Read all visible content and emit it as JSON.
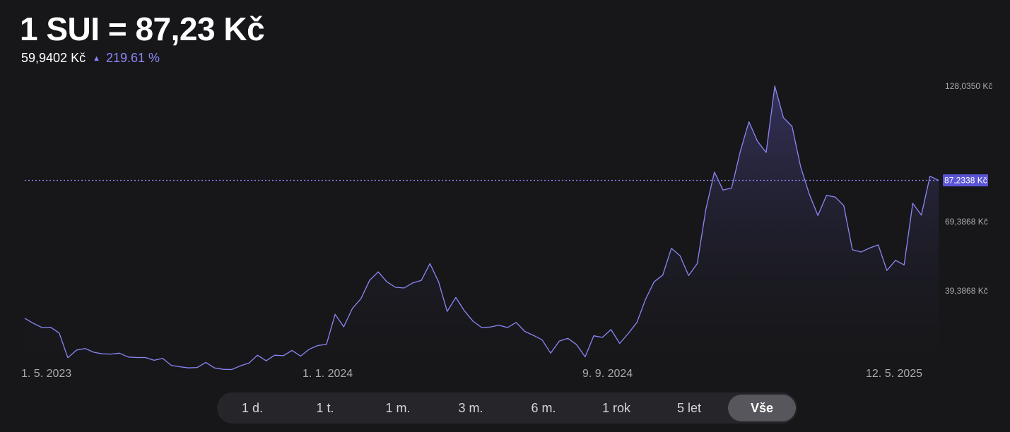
{
  "header": {
    "title": "1 SUI = 87,23 Kč",
    "base_price": "59,9402 Kč",
    "change_arrow": "▲",
    "change_pct": "219.61 %"
  },
  "colors": {
    "background": "#17171a",
    "line": "#8a86f5",
    "area_top": "#3a3766",
    "current_badge": "#5a55d6",
    "axis_text": "#a8a8ae"
  },
  "ranges": {
    "items": [
      "1 d.",
      "1 t.",
      "1 m.",
      "3 m.",
      "6 m.",
      "1 rok",
      "5 let",
      "Vše"
    ],
    "active": "Vše"
  },
  "chart_data": {
    "type": "area",
    "x_tick_labels": [
      "1. 5. 2023",
      "1. 1. 2024",
      "9. 9. 2024",
      "12. 5. 2025"
    ],
    "y_tick_labels": [
      "128,0350 Kč",
      "69,3868 Kč",
      "39,3868 Kč"
    ],
    "y_ticks": [
      128.035,
      69.3868,
      39.3868
    ],
    "current_label": "87,2338 Kč",
    "current_value": 87.2338,
    "ylim": [
      5,
      128.035
    ],
    "x_range": [
      "2023-05-01",
      "2025-06-01"
    ],
    "grid": false,
    "series": [
      {
        "values": [
          27.5,
          25.3,
          23.5,
          23.6,
          21.1,
          10.4,
          13.7,
          14.4,
          12.8,
          12.1,
          12.0,
          12.4,
          10.7,
          10.5,
          10.5,
          9.3,
          10.1,
          7.1,
          6.5,
          6.0,
          6.2,
          8.4,
          6.0,
          5.4,
          5.3,
          6.9,
          8.1,
          11.5,
          9.1,
          11.5,
          11.3,
          13.6,
          11.1,
          14.1,
          15.7,
          16.2,
          29.2,
          23.8,
          31.7,
          36.0,
          43.9,
          47.6,
          43.3,
          40.9,
          40.6,
          42.8,
          43.9,
          51.2,
          43.3,
          30.5,
          36.5,
          30.7,
          26.2,
          23.5,
          23.7,
          24.5,
          23.5,
          25.7,
          21.8,
          20.1,
          18.2,
          12.4,
          17.6,
          18.8,
          16.1,
          10.8,
          19.9,
          19.2,
          22.6,
          16.6,
          20.9,
          25.7,
          35.7,
          43.3,
          46.2,
          57.8,
          54.6,
          46.0,
          51.2,
          74.7,
          90.8,
          83.0,
          83.9,
          99.8,
          112.6,
          104.1,
          99.3,
          128.035,
          114.4,
          110.6,
          93.1,
          81.3,
          72.0,
          80.7,
          80.0,
          76.3,
          57.2,
          56.2,
          57.9,
          59.3,
          48.2,
          52.6,
          50.6,
          77.3,
          72.2,
          89.0,
          87.2338
        ]
      }
    ]
  }
}
